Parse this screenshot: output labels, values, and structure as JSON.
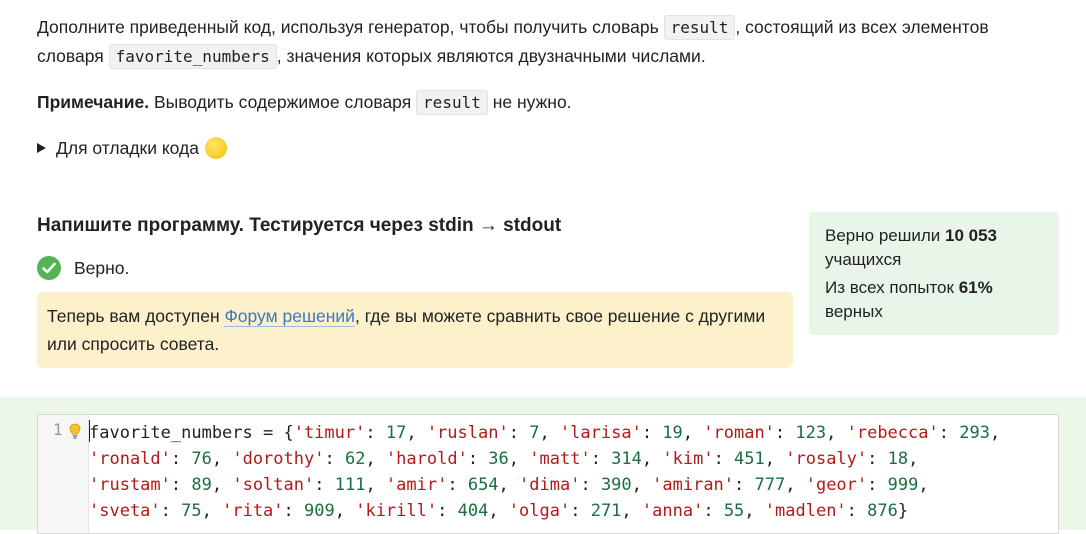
{
  "task": {
    "p1_before": "Дополните приведенный код, используя генератор, чтобы получить словарь ",
    "p1_code1": "result",
    "p1_mid": ", состоящий из всех элементов словаря ",
    "p1_code2": "favorite_numbers",
    "p1_after": ", значения которых являются двузначными числами.",
    "note_label": "Примечание.",
    "note_before": " Выводить содержимое словаря ",
    "note_code": "result",
    "note_after": " не нужно."
  },
  "debug": {
    "label": "Для отладки кода",
    "icon": "yellow-circle-emoji"
  },
  "program": {
    "heading": "Напишите программу. Тестируется через stdin → stdout"
  },
  "verdict": {
    "text": "Верно.",
    "icon": "check-circle-icon",
    "color": "#52b455"
  },
  "notice": {
    "before": "Теперь вам доступен ",
    "link": "Форум решений",
    "after": ", где вы можете сравнить свое решение с другими или спросить совета."
  },
  "stats": {
    "solved_prefix": "Верно решили ",
    "solved_count": "10 053",
    "solved_suffix": "учащихся",
    "attempts_prefix": "Из всех попыток ",
    "attempts_percent": "61%",
    "attempts_suffix": "верных"
  },
  "editor": {
    "line_number": "1",
    "variable": "favorite_numbers",
    "entries": [
      {
        "key": "timur",
        "value": "17"
      },
      {
        "key": "ruslan",
        "value": "7"
      },
      {
        "key": "larisa",
        "value": "19"
      },
      {
        "key": "roman",
        "value": "123"
      },
      {
        "key": "rebecca",
        "value": "293"
      },
      {
        "key": "ronald",
        "value": "76"
      },
      {
        "key": "dorothy",
        "value": "62"
      },
      {
        "key": "harold",
        "value": "36"
      },
      {
        "key": "matt",
        "value": "314"
      },
      {
        "key": "kim",
        "value": "451"
      },
      {
        "key": "rosaly",
        "value": "18"
      },
      {
        "key": "rustam",
        "value": "89"
      },
      {
        "key": "soltan",
        "value": "111"
      },
      {
        "key": "amir",
        "value": "654"
      },
      {
        "key": "dima",
        "value": "390"
      },
      {
        "key": "amiran",
        "value": "777"
      },
      {
        "key": "geor",
        "value": "999"
      },
      {
        "key": "sveta",
        "value": "75"
      },
      {
        "key": "rita",
        "value": "909"
      },
      {
        "key": "kirill",
        "value": "404"
      },
      {
        "key": "olga",
        "value": "271"
      },
      {
        "key": "anna",
        "value": "55"
      },
      {
        "key": "madlen",
        "value": "876"
      }
    ],
    "colors": {
      "string": "#b11a1a",
      "number": "#1b6e40",
      "background": "#ecf7ea"
    }
  }
}
